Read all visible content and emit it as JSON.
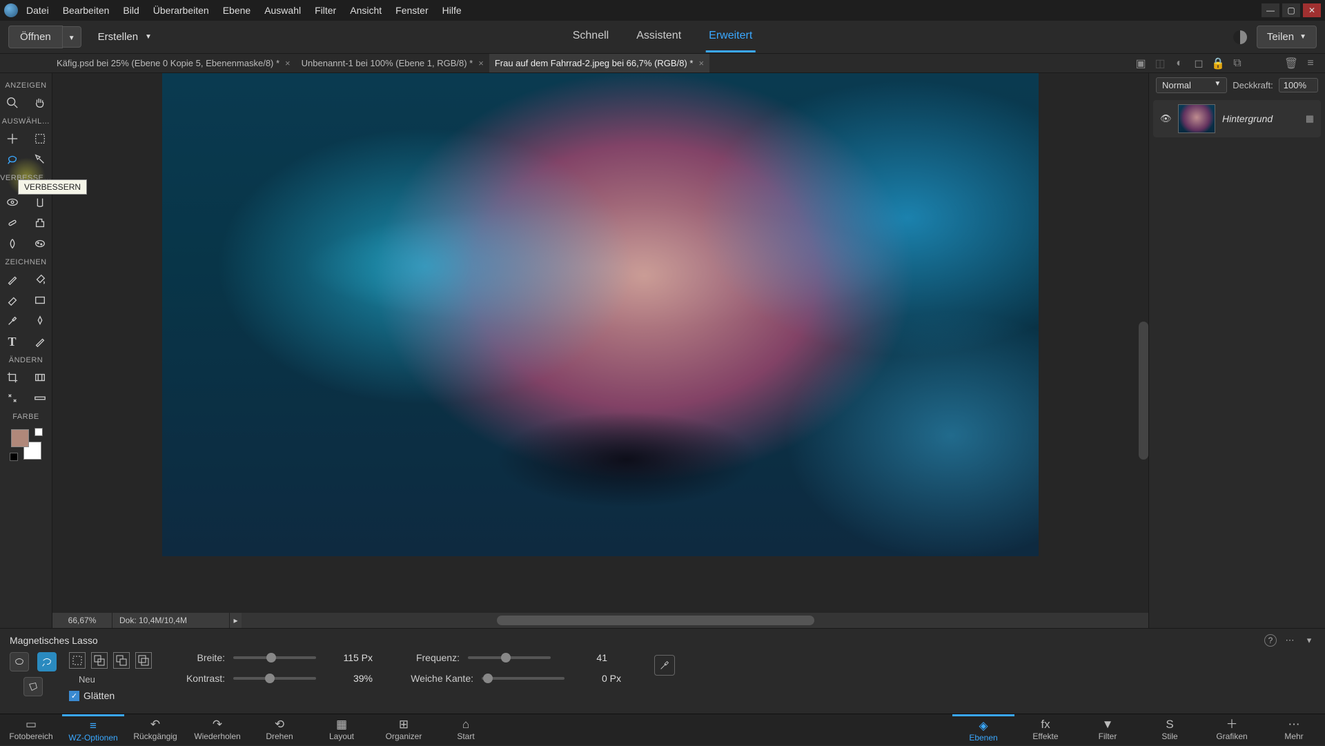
{
  "menu": [
    "Datei",
    "Bearbeiten",
    "Bild",
    "Überarbeiten",
    "Ebene",
    "Auswahl",
    "Filter",
    "Ansicht",
    "Fenster",
    "Hilfe"
  ],
  "actionbar": {
    "open": "Öffnen",
    "create": "Erstellen",
    "modes": {
      "fast": "Schnell",
      "assist": "Assistent",
      "expert": "Erweitert"
    },
    "share": "Teilen"
  },
  "docTabs": [
    "Käfig.psd bei 25% (Ebene 0 Kopie 5, Ebenenmaske/8) *",
    "Unbenannt-1 bei 100% (Ebene 1, RGB/8) *",
    "Frau auf dem Fahrrad-2.jpeg bei 66,7% (RGB/8) *"
  ],
  "layersPanel": {
    "blendMode": "Normal",
    "opacityLabel": "Deckkraft:",
    "opacityValue": "100%",
    "layerName": "Hintergrund"
  },
  "toolbar": {
    "sections": {
      "view": "ANZEIGEN",
      "select": "AUSWÄHL…",
      "enhance": "VERBESSE…",
      "draw": "ZEICHNEN",
      "modify": "ÄNDERN",
      "color": "FARBE"
    },
    "tooltip": "VERBESSERN"
  },
  "status": {
    "zoom": "66,67%",
    "doc": "Dok: 10,4M/10,4M"
  },
  "options": {
    "toolName": "Magnetisches Lasso",
    "neu": "Neu",
    "glatten": "Glätten",
    "breite": {
      "label": "Breite:",
      "value": "115 Px",
      "pct": 40
    },
    "kontrast": {
      "label": "Kontrast:",
      "value": "39%",
      "pct": 38
    },
    "frequenz": {
      "label": "Frequenz:",
      "value": "41",
      "pct": 40
    },
    "weiche": {
      "label": "Weiche Kante:",
      "value": "0 Px",
      "pct": 2
    }
  },
  "bottomBar": {
    "left": [
      {
        "label": "Fotobereich",
        "icon": "▭"
      },
      {
        "label": "WZ-Optionen",
        "icon": "≡"
      },
      {
        "label": "Rückgängig",
        "icon": "↶"
      },
      {
        "label": "Wiederholen",
        "icon": "↷"
      },
      {
        "label": "Drehen",
        "icon": "⟲"
      },
      {
        "label": "Layout",
        "icon": "▦"
      },
      {
        "label": "Organizer",
        "icon": "⊞"
      },
      {
        "label": "Start",
        "icon": "⌂"
      }
    ],
    "right": [
      {
        "label": "Ebenen",
        "icon": "◈"
      },
      {
        "label": "Effekte",
        "icon": "fx"
      },
      {
        "label": "Filter",
        "icon": "▼"
      },
      {
        "label": "Stile",
        "icon": "S"
      },
      {
        "label": "Grafiken",
        "icon": "＋"
      },
      {
        "label": "Mehr",
        "icon": "⋯"
      }
    ]
  }
}
